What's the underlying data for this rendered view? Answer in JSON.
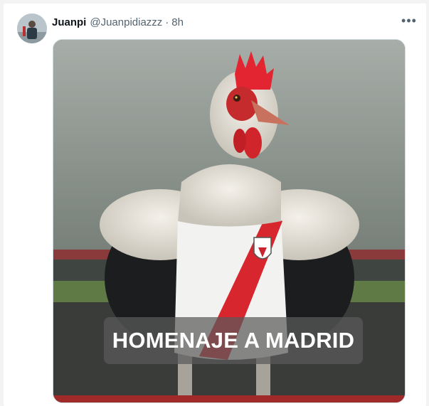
{
  "tweet": {
    "author_name": "Juanpi",
    "author_handle": "@Juanpidiazzz",
    "separator": "·",
    "time": "8h",
    "more_label": "•••"
  },
  "media": {
    "overlay_text": "HOMENAJE A MADRID",
    "description_icon": "rooster-in-football-shirt-image"
  },
  "colors": {
    "stripe_red": "#d8262e",
    "comb_red": "#e22530",
    "background_fog": "#7b827d"
  }
}
